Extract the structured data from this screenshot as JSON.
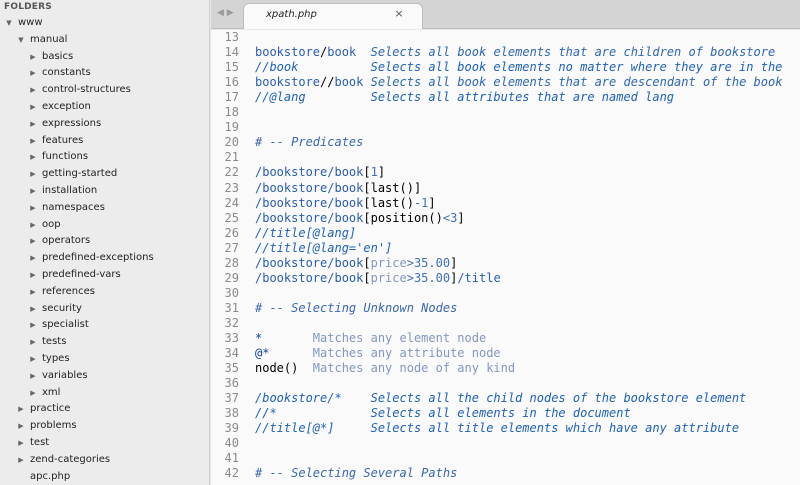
{
  "sidebar": {
    "header": "FOLDERS",
    "items": [
      {
        "label": "www",
        "depth": 0,
        "expanded": true
      },
      {
        "label": "manual",
        "depth": 1,
        "expanded": true
      },
      {
        "label": "basics",
        "depth": 2,
        "expanded": false
      },
      {
        "label": "constants",
        "depth": 2,
        "expanded": false
      },
      {
        "label": "control-structures",
        "depth": 2,
        "expanded": false
      },
      {
        "label": "exception",
        "depth": 2,
        "expanded": false
      },
      {
        "label": "expressions",
        "depth": 2,
        "expanded": false
      },
      {
        "label": "features",
        "depth": 2,
        "expanded": false
      },
      {
        "label": "functions",
        "depth": 2,
        "expanded": false
      },
      {
        "label": "getting-started",
        "depth": 2,
        "expanded": false
      },
      {
        "label": "installation",
        "depth": 2,
        "expanded": false
      },
      {
        "label": "namespaces",
        "depth": 2,
        "expanded": false
      },
      {
        "label": "oop",
        "depth": 2,
        "expanded": false
      },
      {
        "label": "operators",
        "depth": 2,
        "expanded": false
      },
      {
        "label": "predefined-exceptions",
        "depth": 2,
        "expanded": false
      },
      {
        "label": "predefined-vars",
        "depth": 2,
        "expanded": false
      },
      {
        "label": "references",
        "depth": 2,
        "expanded": false
      },
      {
        "label": "security",
        "depth": 2,
        "expanded": false
      },
      {
        "label": "specialist",
        "depth": 2,
        "expanded": false
      },
      {
        "label": "tests",
        "depth": 2,
        "expanded": false
      },
      {
        "label": "types",
        "depth": 2,
        "expanded": false
      },
      {
        "label": "variables",
        "depth": 2,
        "expanded": false
      },
      {
        "label": "xml",
        "depth": 2,
        "expanded": false
      },
      {
        "label": "practice",
        "depth": 1,
        "expanded": false
      },
      {
        "label": "problems",
        "depth": 1,
        "expanded": false
      },
      {
        "label": "test",
        "depth": 1,
        "expanded": false
      },
      {
        "label": "zend-categories",
        "depth": 1,
        "expanded": false
      },
      {
        "label": "apc.php",
        "depth": 1,
        "file": true
      }
    ]
  },
  "tabs": {
    "active_title": "xpath.php",
    "close_glyph": "×",
    "ghost": "◀ ▶"
  },
  "editor": {
    "lines": [
      {
        "n": "13",
        "s": []
      },
      {
        "n": "14",
        "s": [
          [
            "p",
            "bookstore"
          ],
          [
            "b",
            "/"
          ],
          [
            "p",
            "book"
          ],
          [
            "c",
            "  Selects all book elements that are children of bookstore"
          ]
        ]
      },
      {
        "n": "15",
        "s": [
          [
            "ec",
            "//book          Selects all book elements no matter where they are in the"
          ]
        ]
      },
      {
        "n": "16",
        "s": [
          [
            "p",
            "bookstore"
          ],
          [
            "b",
            "//"
          ],
          [
            "p",
            "book"
          ],
          [
            "c",
            " Selects all book elements that are descendant of the book"
          ]
        ]
      },
      {
        "n": "17",
        "s": [
          [
            "ec",
            "//@lang         Selects all attributes that are named lang"
          ]
        ]
      },
      {
        "n": "18",
        "s": []
      },
      {
        "n": "19",
        "s": []
      },
      {
        "n": "20",
        "s": [
          [
            "cm",
            "# -- Predicates"
          ]
        ]
      },
      {
        "n": "21",
        "s": []
      },
      {
        "n": "22",
        "s": [
          [
            "p",
            "/bookstore/book"
          ],
          [
            "b",
            "["
          ],
          [
            "n",
            "1"
          ],
          [
            "b",
            "]"
          ]
        ]
      },
      {
        "n": "23",
        "s": [
          [
            "p",
            "/bookstore/book"
          ],
          [
            "b",
            "[last()]"
          ]
        ]
      },
      {
        "n": "24",
        "s": [
          [
            "p",
            "/bookstore/book"
          ],
          [
            "b",
            "[last()"
          ],
          [
            "n",
            "-1"
          ],
          [
            "b",
            "]"
          ]
        ]
      },
      {
        "n": "25",
        "s": [
          [
            "p",
            "/bookstore/book"
          ],
          [
            "b",
            "[position()"
          ],
          [
            "n",
            "<3"
          ],
          [
            "b",
            "]"
          ]
        ]
      },
      {
        "n": "26",
        "s": [
          [
            "ec",
            "//title[@lang]"
          ]
        ]
      },
      {
        "n": "27",
        "s": [
          [
            "ec",
            "//title[@lang='en']"
          ]
        ]
      },
      {
        "n": "28",
        "s": [
          [
            "p",
            "/bookstore/book"
          ],
          [
            "b",
            "["
          ],
          [
            "g",
            "price"
          ],
          [
            "n",
            ">35.00"
          ],
          [
            "b",
            "]"
          ]
        ]
      },
      {
        "n": "29",
        "s": [
          [
            "p",
            "/bookstore/book"
          ],
          [
            "b",
            "["
          ],
          [
            "g",
            "price"
          ],
          [
            "n",
            ">35.00"
          ],
          [
            "b",
            "]"
          ],
          [
            "p",
            "/title"
          ]
        ]
      },
      {
        "n": "30",
        "s": []
      },
      {
        "n": "31",
        "s": [
          [
            "cm",
            "# -- Selecting Unknown Nodes"
          ]
        ]
      },
      {
        "n": "32",
        "s": []
      },
      {
        "n": "33",
        "s": [
          [
            "k",
            "*"
          ],
          [
            "g",
            "       Matches any element node"
          ]
        ]
      },
      {
        "n": "34",
        "s": [
          [
            "k",
            "@*"
          ],
          [
            "g",
            "      Matches any attribute node"
          ]
        ]
      },
      {
        "n": "35",
        "s": [
          [
            "b",
            "node()"
          ],
          [
            "g",
            "  Matches any node of any kind"
          ]
        ]
      },
      {
        "n": "36",
        "s": []
      },
      {
        "n": "37",
        "s": [
          [
            "ec",
            "/bookstore/*    Selects all the child nodes of the bookstore element"
          ]
        ]
      },
      {
        "n": "38",
        "s": [
          [
            "ec",
            "//*             Selects all elements in the document"
          ]
        ]
      },
      {
        "n": "39",
        "s": [
          [
            "ec",
            "//title[@*]     Selects all title elements which have any attribute"
          ]
        ]
      },
      {
        "n": "40",
        "s": []
      },
      {
        "n": "41",
        "s": []
      },
      {
        "n": "42",
        "s": [
          [
            "cm",
            "# -- Selecting Several Paths"
          ]
        ]
      }
    ]
  }
}
